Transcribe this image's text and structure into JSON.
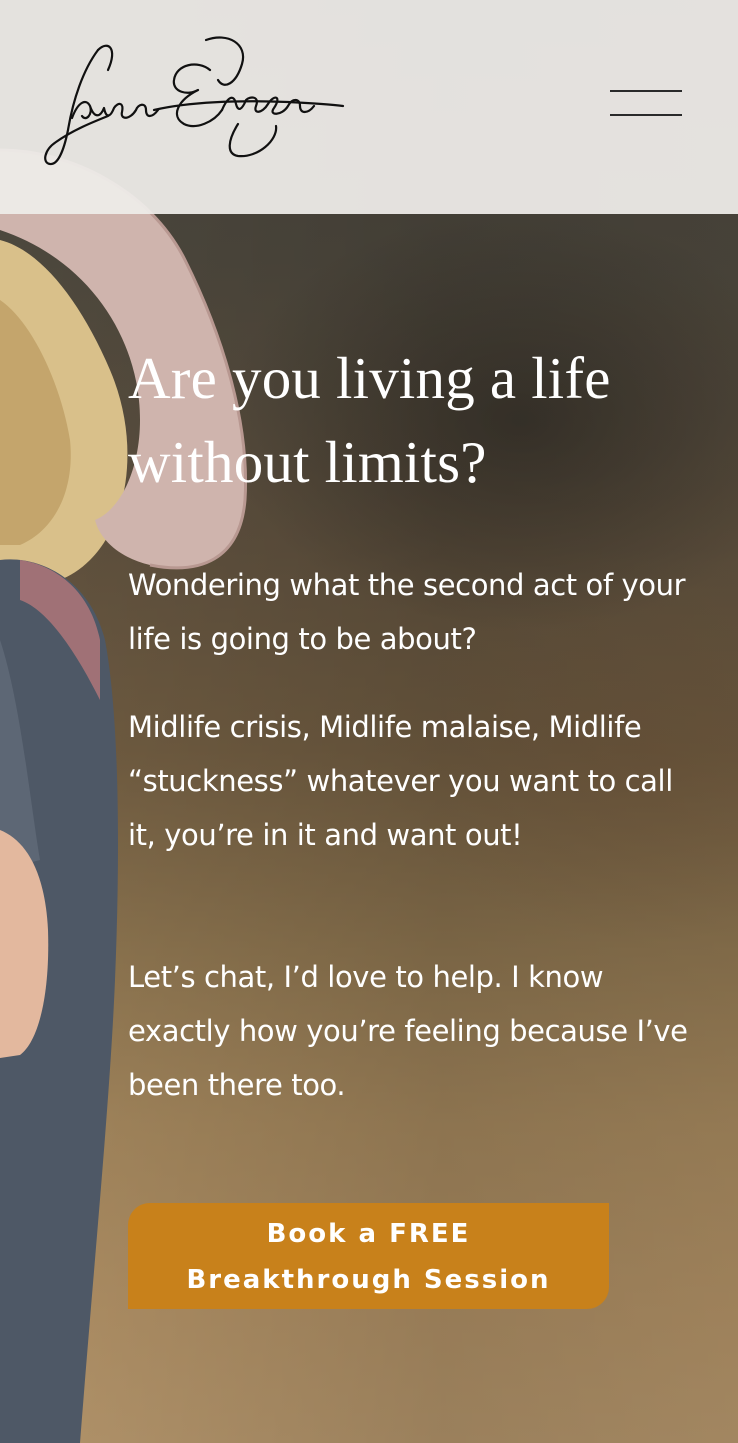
{
  "header": {
    "logo_alt": "Laura Enzor",
    "menu_icon": "hamburger-menu-icon"
  },
  "hero": {
    "headline": "Are you living a life without limits?",
    "paragraphs": [
      "Wondering what the second act of your life is going to be about?",
      "Midlife crisis, Midlife malaise, Midlife “stuckness” whatever you want to call it, you’re in it and want out!",
      "Let’s chat, I’d love to help. I know exactly how you’re feeling because I’ve been there too."
    ],
    "cta": {
      "line1": "Book a FREE",
      "line2": "Breakthrough Session"
    }
  },
  "colors": {
    "accent": "#c8811b",
    "header_bg": "#eeece9",
    "text": "#ffffff"
  }
}
